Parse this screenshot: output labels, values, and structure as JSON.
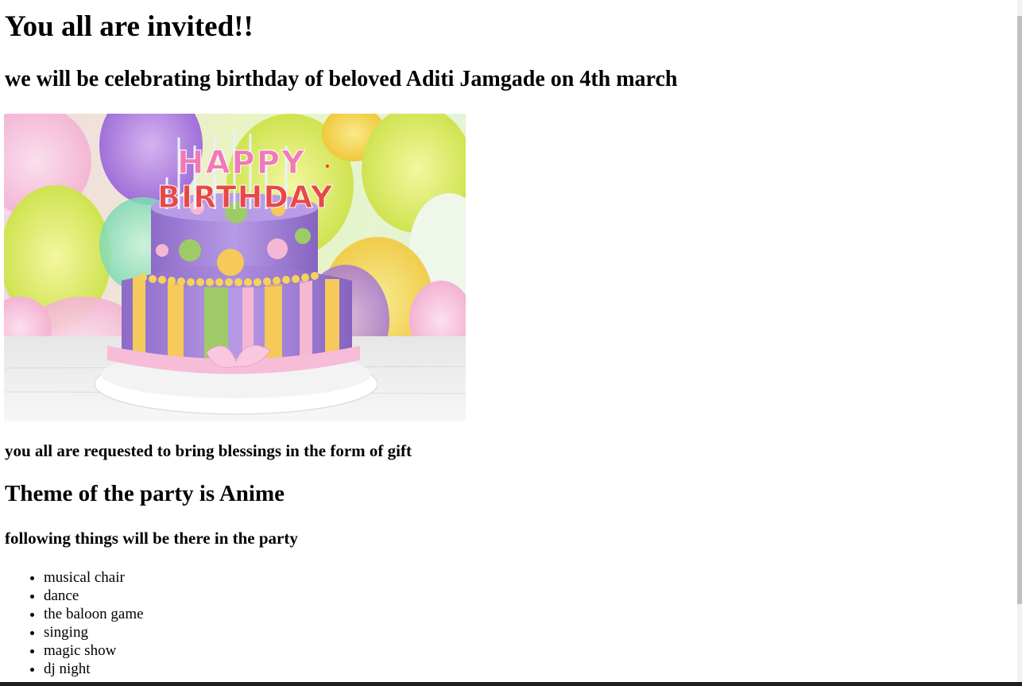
{
  "invitation": {
    "title": "You all are invited!!",
    "subtitle": "we will be celebrating birthday of beloved Aditi Jamgade on 4th march",
    "cake_text_top": "HAPPY",
    "cake_text_bottom": "BIRTHDAY",
    "request": "you all are requested to bring blessings in the form of gift",
    "theme": "Theme of the party is Anime",
    "following": "following things will be there in the party",
    "activities": [
      "musical chair",
      "dance",
      "the baloon game",
      "singing",
      "magic show",
      "dj night"
    ]
  }
}
